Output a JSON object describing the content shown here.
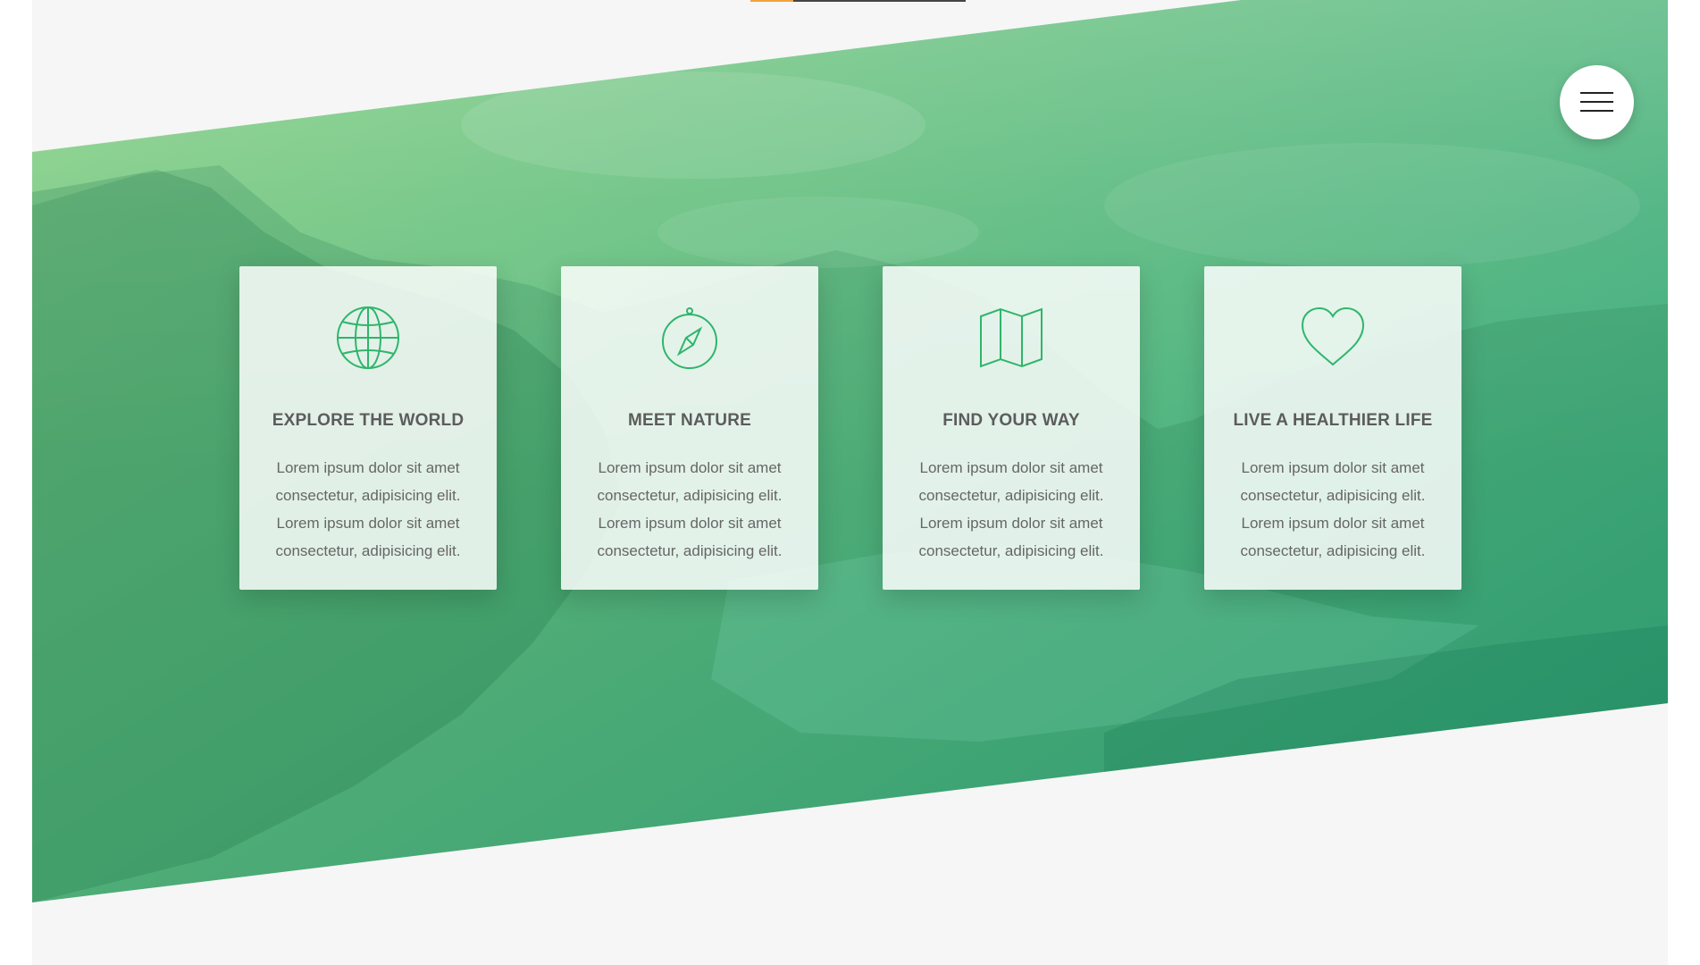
{
  "colors": {
    "gradient_start": "#8fd48a",
    "gradient_end": "#27a07a",
    "background": "#f6f6f6",
    "icon_stroke": "#2fb56b",
    "accent": "#f3a23c"
  },
  "menu": {
    "icon": "hamburger-menu-icon"
  },
  "features": [
    {
      "icon": "globe-icon",
      "title": "EXPLORE THE WORLD",
      "text": "Lorem ipsum dolor sit amet consectetur, adipisicing elit. Lorem ipsum dolor sit amet consectetur, adipisicing elit."
    },
    {
      "icon": "compass-icon",
      "title": "MEET NATURE",
      "text": "Lorem ipsum dolor sit amet consectetur, adipisicing elit. Lorem ipsum dolor sit amet consectetur, adipisicing elit."
    },
    {
      "icon": "map-icon",
      "title": "FIND YOUR WAY",
      "text": "Lorem ipsum dolor sit amet consectetur, adipisicing elit. Lorem ipsum dolor sit amet consectetur, adipisicing elit."
    },
    {
      "icon": "heart-icon",
      "title": "LIVE A HEALTHIER LIFE",
      "text": "Lorem ipsum dolor sit amet consectetur, adipisicing elit. Lorem ipsum dolor sit amet consectetur, adipisicing elit."
    }
  ]
}
